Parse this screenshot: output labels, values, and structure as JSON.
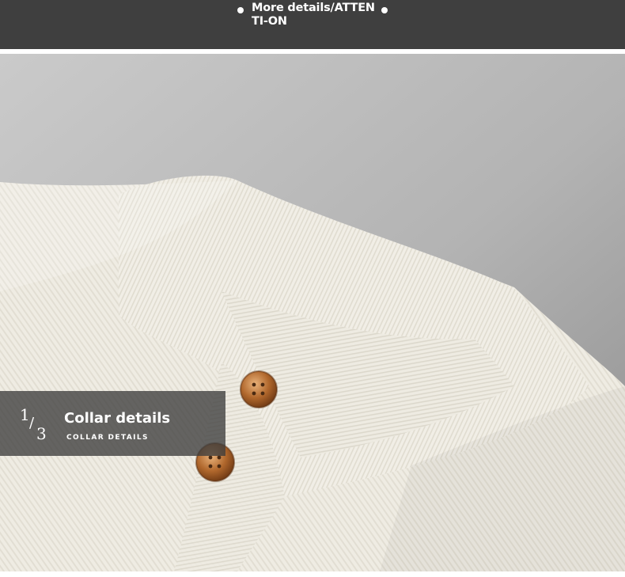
{
  "banner": {
    "title": "More details/ATTENTI-ON"
  },
  "caption": {
    "page_current": "1",
    "page_total": "3",
    "title": "Collar details",
    "subtitle": "COLLAR DETAILS"
  },
  "colors": {
    "banner_bg": "#3f3f3f",
    "sweater": "#efece3",
    "button": "#b06a2e"
  }
}
